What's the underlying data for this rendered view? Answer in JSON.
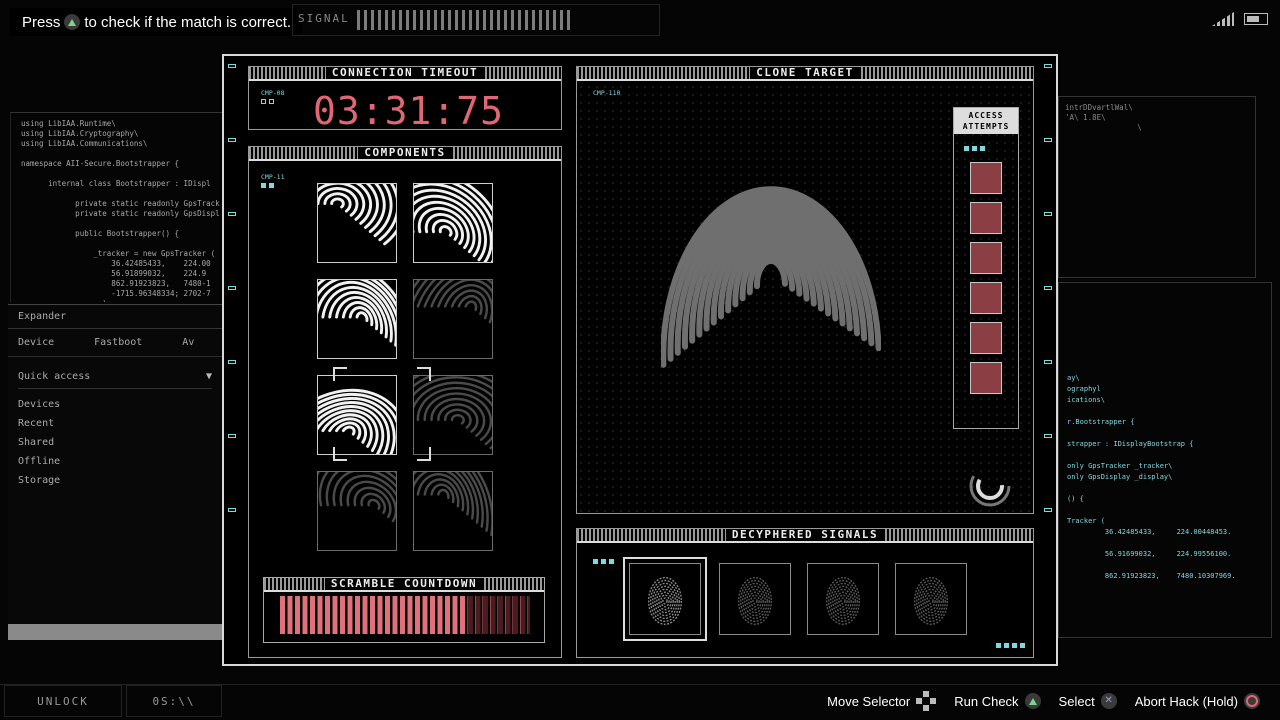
{
  "hint": {
    "prefix": "Press",
    "suffix": "to check if the match is correct."
  },
  "top": {
    "signal_label": "SIGNAL"
  },
  "code_left": "using LibIAA.Runtime\\\nusing LibIAA.Cryptography\\\nusing LibIAA.Communications\\\n\nnamespace AII-Secure.Bootstrapper {\n\n      internal class Bootstrapper : IDispl\n\n            private static readonly GpsTrack\n            private static readonly GpsDispl\n\n            public Bootstrapper() {\n\n                _tracker = new GpsTracker (\n                    36.42485433,    224.00\n                    56.91899032,    224.9\n                    862.91923823,   7480-1\n                    -1715.96348334; 2702-7\n                  );",
  "side_panel": {
    "title": "Expander",
    "tabs": [
      "Device",
      "Fastboot",
      "Av"
    ],
    "quick_access": "Quick access",
    "items": [
      "Devices",
      "Recent",
      "Shared",
      "Offline",
      "Storage"
    ]
  },
  "code_right_top": "intrDDvartlWal\\\n'A\\ 1.8E\\\n                \\",
  "code_right_bottom": "ay\\\nographyl\nications\\\n\nr.Bootstrapper {\n\nstrapper : IDisplayBootstrap {\n\nonly GpsTracker _tracker\\\nonly GpsDisplay _display\\\n\n() {\n\nTracker (\n         36.42485433,     224.00448453.\n\n         56.91699032,     224.99556100.\n\n         862.91923823,    7480.10307969.",
  "main": {
    "connection": {
      "title": "CONNECTION TIMEOUT",
      "tag": "CMP-08",
      "timer": "03:31:75"
    },
    "components": {
      "title": "COMPONENTS",
      "tag": "CMP-11"
    },
    "scramble": {
      "title": "SCRAMBLE COUNTDOWN",
      "progress": 0.78
    },
    "clone": {
      "title": "CLONE TARGET",
      "tag": "CMP-110"
    },
    "attempts": {
      "title_line1": "ACCESS",
      "title_line2": "ATTEMPTS",
      "count": 6
    },
    "signals": {
      "title": "DECYPHERED SIGNALS"
    }
  },
  "bottom": {
    "unlock": "UNLOCK",
    "code": "0S:\\\\",
    "move": "Move Selector",
    "run": "Run Check",
    "select": "Select",
    "abort": "Abort Hack (Hold)"
  },
  "colors": {
    "accent_red": "#e06874",
    "accent_cyan": "#7fd8e0",
    "attempt_box": "#8b3e44"
  },
  "icons": [
    "triangle-button-icon",
    "cross-button-icon",
    "circle-button-icon",
    "dpad-icon",
    "wifi-icon",
    "battery-icon"
  ]
}
